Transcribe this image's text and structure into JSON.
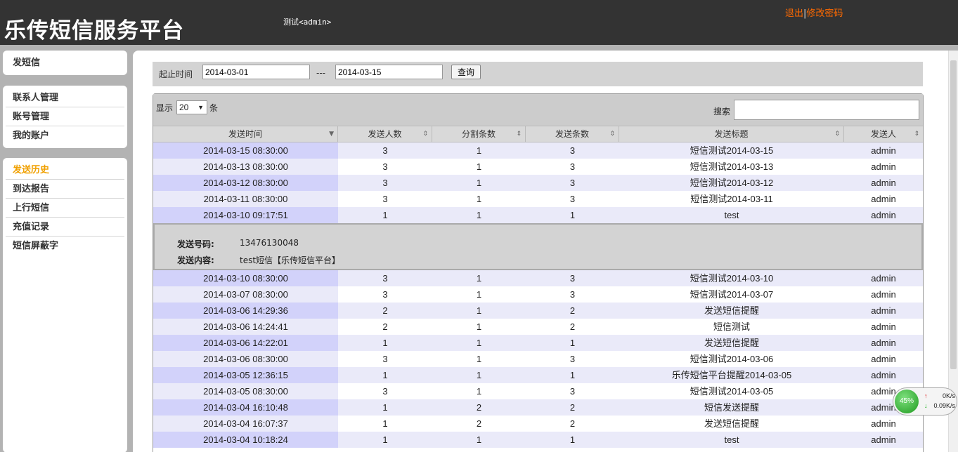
{
  "header": {
    "logo": "乐传短信服务平台",
    "user": "测试<admin>",
    "logout": "退出",
    "separator": "|",
    "change_password": "修改密码"
  },
  "sidebar": {
    "group1": [
      {
        "label": "发短信"
      }
    ],
    "group2": [
      {
        "label": "联系人管理"
      },
      {
        "label": "账号管理"
      },
      {
        "label": "我的账户"
      }
    ],
    "group3": [
      {
        "label": "发送历史"
      },
      {
        "label": "到达报告"
      },
      {
        "label": "上行短信"
      },
      {
        "label": "充值记录"
      },
      {
        "label": "短信屏蔽字"
      }
    ]
  },
  "filter": {
    "label": "起止时间",
    "start": "2014-03-01",
    "dash": "---",
    "end": "2014-03-15",
    "query": "查询"
  },
  "table": {
    "show_label": "显示",
    "page_size": "20",
    "unit": "条",
    "search_label": "搜索",
    "columns": [
      "发送时间",
      "发送人数",
      "分割条数",
      "发送条数",
      "发送标题",
      "发送人"
    ],
    "rows_before": [
      [
        "2014-03-15 08:30:00",
        "3",
        "1",
        "3",
        "短信测试2014-03-15",
        "admin"
      ],
      [
        "2014-03-13 08:30:00",
        "3",
        "1",
        "3",
        "短信测试2014-03-13",
        "admin"
      ],
      [
        "2014-03-12 08:30:00",
        "3",
        "1",
        "3",
        "短信测试2014-03-12",
        "admin"
      ],
      [
        "2014-03-11 08:30:00",
        "3",
        "1",
        "3",
        "短信测试2014-03-11",
        "admin"
      ],
      [
        "2014-03-10 09:17:51",
        "1",
        "1",
        "1",
        "test",
        "admin"
      ]
    ],
    "detail": {
      "number_label": "发送号码:",
      "number": "13476130048",
      "content_label": "发送内容:",
      "content": "test短信【乐传短信平台】"
    },
    "rows_after": [
      [
        "2014-03-10 08:30:00",
        "3",
        "1",
        "3",
        "短信测试2014-03-10",
        "admin"
      ],
      [
        "2014-03-07 08:30:00",
        "3",
        "1",
        "3",
        "短信测试2014-03-07",
        "admin"
      ],
      [
        "2014-03-06 14:29:36",
        "2",
        "1",
        "2",
        "发送短信提醒",
        "admin"
      ],
      [
        "2014-03-06 14:24:41",
        "2",
        "1",
        "2",
        "短信测试",
        "admin"
      ],
      [
        "2014-03-06 14:22:01",
        "1",
        "1",
        "1",
        "发送短信提醒",
        "admin"
      ],
      [
        "2014-03-06 08:30:00",
        "3",
        "1",
        "3",
        "短信测试2014-03-06",
        "admin"
      ],
      [
        "2014-03-05 12:36:15",
        "1",
        "1",
        "1",
        "乐传短信平台提醒2014-03-05",
        "admin"
      ],
      [
        "2014-03-05 08:30:00",
        "3",
        "1",
        "3",
        "短信测试2014-03-05",
        "admin"
      ],
      [
        "2014-03-04 16:10:48",
        "1",
        "2",
        "2",
        "短信发送提醒",
        "admin"
      ],
      [
        "2014-03-04 16:07:37",
        "1",
        "2",
        "2",
        "发送短信提醒",
        "admin"
      ],
      [
        "2014-03-04 10:18:24",
        "1",
        "1",
        "1",
        "test",
        "admin"
      ]
    ]
  },
  "net_widget": {
    "percent": "45%",
    "up": "0K/s",
    "down": "0.09K/s"
  },
  "colors": {
    "header_bg": "#333333",
    "accent": "#ff6a00",
    "active_nav": "#f0a000",
    "row_highlight": "#d2d2fa"
  }
}
